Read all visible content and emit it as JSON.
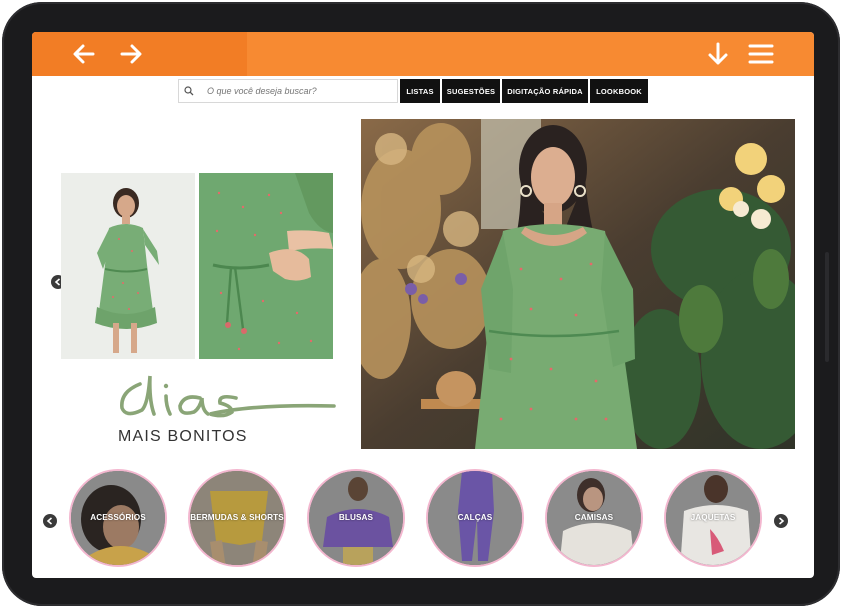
{
  "header": {
    "back_icon": "arrow-left-icon",
    "forward_icon": "arrow-right-icon",
    "download_icon": "arrow-down-icon",
    "menu_icon": "hamburger-menu-icon",
    "accent_color": "#f78a32"
  },
  "search": {
    "placeholder": "O que você deseja buscar?",
    "icon": "search-icon"
  },
  "nav": {
    "listas": "LISTAS",
    "sugestoes": "SUGESTÕES",
    "digitacao_rapida": "DIGITAÇÃO RÁPIDA",
    "lookbook": "LOOKBOOK"
  },
  "brand": {
    "logo_word": "dias",
    "tagline": "MAIS BONITOS"
  },
  "categories": [
    {
      "label": "ACESSÓRIOS"
    },
    {
      "label": "BERMUDAS & SHORTS"
    },
    {
      "label": "BLUSAS"
    },
    {
      "label": "CALÇAS"
    },
    {
      "label": "CAMISAS"
    },
    {
      "label": "JAQUETAS"
    }
  ]
}
